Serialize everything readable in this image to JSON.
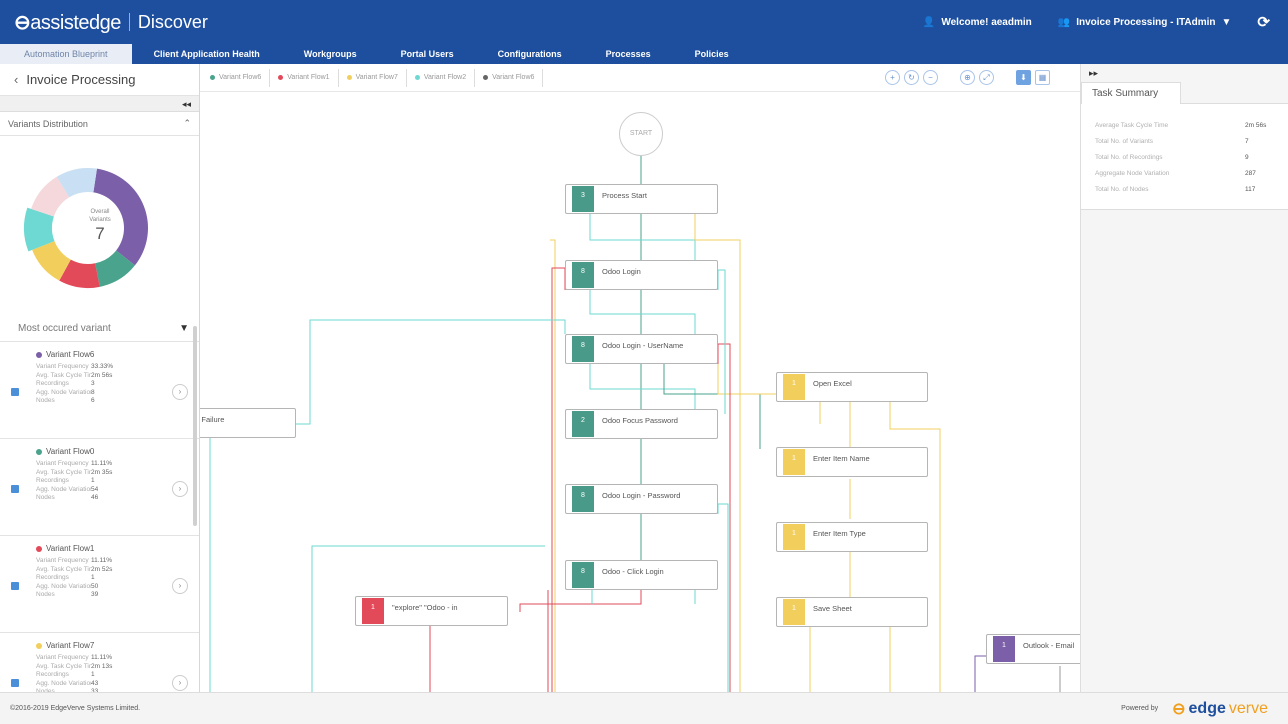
{
  "header": {
    "brand_main": "assistedge",
    "brand_sub": "Discover",
    "welcome": "Welcome! aeadmin",
    "process_selector": "Invoice Processing - ITAdmin",
    "colors": {
      "bar": "#1e4f9e"
    }
  },
  "nav": {
    "items": [
      "Automation Blueprint",
      "Client Application Health",
      "Workgroups",
      "Portal Users",
      "Configurations",
      "Processes",
      "Policies"
    ]
  },
  "left": {
    "title": "Invoice Processing",
    "distribution_title": "Variants Distribution",
    "overall_label": "Overall Variants",
    "overall_count": "7",
    "most_label": "Most occured variant",
    "variants": [
      {
        "name": "Variant Flow6",
        "color": "#7b5fa8",
        "frequency": "33.33%",
        "avg_time": "2m 56s",
        "recordings": "3",
        "agg_node": "8",
        "nodes": "6"
      },
      {
        "name": "Variant Flow0",
        "color": "#4aa38c",
        "frequency": "11.11%",
        "avg_time": "2m 35s",
        "recordings": "1",
        "agg_node": "54",
        "nodes": "46"
      },
      {
        "name": "Variant Flow1",
        "color": "#e24a5a",
        "frequency": "11.11%",
        "avg_time": "2m 52s",
        "recordings": "1",
        "agg_node": "50",
        "nodes": "39"
      },
      {
        "name": "Variant Flow7",
        "color": "#f2cf5c",
        "frequency": "11.11%",
        "avg_time": "2m 13s",
        "recordings": "1",
        "agg_node": "43",
        "nodes": "33"
      }
    ],
    "stat_labels": {
      "frequency": "Variant Frequency",
      "avg_time": "Avg. Task Cycle Time",
      "recordings": "Recordings",
      "agg_node": "Agg. Node Variation",
      "nodes": "Nodes"
    },
    "donut": [
      {
        "value": 33,
        "color": "#7b5fa8"
      },
      {
        "value": 11,
        "color": "#4aa38c"
      },
      {
        "value": 11,
        "color": "#e24a5a"
      },
      {
        "value": 11,
        "color": "#f2cf5c"
      },
      {
        "value": 11,
        "color": "#6ed9d2"
      },
      {
        "value": 11,
        "color": "#f4d8dc"
      },
      {
        "value": 11,
        "color": "#c9dff3"
      }
    ]
  },
  "canvas": {
    "tabs": [
      {
        "label": "Variant Flow6",
        "color": "#4aa38c"
      },
      {
        "label": "Variant Flow1",
        "color": "#e24a5a"
      },
      {
        "label": "Variant Flow7",
        "color": "#f2cf5c"
      },
      {
        "label": "Variant Flow2",
        "color": "#6ed9d2"
      },
      {
        "label": "Variant Flow6",
        "color": "#666666"
      }
    ],
    "start_label": "START",
    "nodes": [
      {
        "id": "n1",
        "label": "Process Start",
        "color": "#4a9a8a",
        "badge": "3"
      },
      {
        "id": "n2",
        "label": "Odoo Login",
        "color": "#4a9a8a",
        "badge": "8"
      },
      {
        "id": "n3",
        "label": "Odoo Login - UserName",
        "color": "#4a9a8a",
        "badge": "8"
      },
      {
        "id": "n4",
        "label": "Odoo Focus Password",
        "color": "#4a9a8a",
        "badge": "2"
      },
      {
        "id": "n5",
        "label": "Odoo Login - Password",
        "color": "#4a9a8a",
        "badge": "8"
      },
      {
        "id": "n6",
        "label": "Odoo - Click Login",
        "color": "#4a9a8a",
        "badge": "8"
      },
      {
        "id": "n7",
        "label": "Open Excel",
        "color": "#f2cf5c",
        "badge": "1"
      },
      {
        "id": "n8",
        "label": "Enter Item Name",
        "color": "#f2cf5c",
        "badge": "1"
      },
      {
        "id": "n9",
        "label": "Enter Item Type",
        "color": "#f2cf5c",
        "badge": "1"
      },
      {
        "id": "n10",
        "label": "Save Sheet",
        "color": "#f2cf5c",
        "badge": "1"
      },
      {
        "id": "n11",
        "label": "Outlook - Email",
        "color": "#7b5fa8",
        "badge": "1"
      },
      {
        "id": "n12",
        "label": "\"explore\" \"Odoo - in",
        "color": "#e24a5a",
        "badge": "1"
      },
      {
        "id": "n13",
        "label": "Login Failure",
        "color": "#ffffff",
        "badge": ""
      }
    ]
  },
  "right": {
    "tab": "Task Summary",
    "rows": [
      {
        "k": "Average Task Cycle Time",
        "v": "2m 56s"
      },
      {
        "k": "Total No. of Variants",
        "v": "7"
      },
      {
        "k": "Total No. of Recordings",
        "v": "9"
      },
      {
        "k": "Aggregate Node Variation",
        "v": "287"
      },
      {
        "k": "Total No. of Nodes",
        "v": "117"
      }
    ]
  },
  "footer": {
    "copyright": "©2016-2019 EdgeVerve Systems Limited.",
    "powered": "Powered by",
    "logo_a": "edge",
    "logo_b": "verve"
  }
}
